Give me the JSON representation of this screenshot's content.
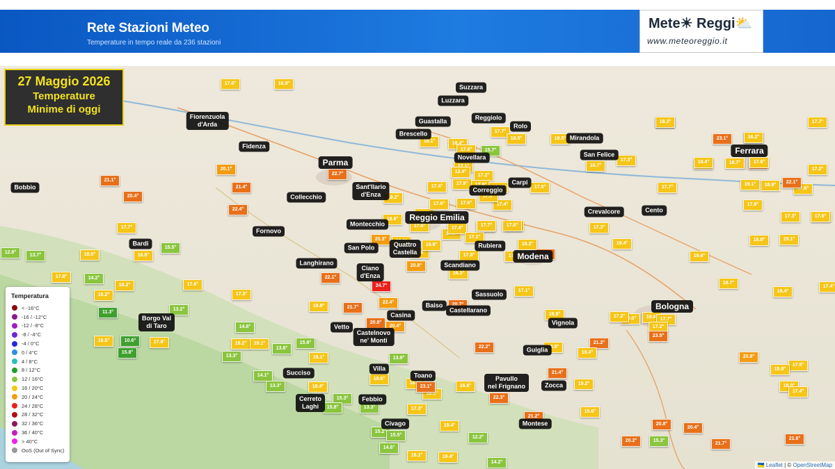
{
  "header": {
    "title": "Rete Stazioni Meteo",
    "subtitle": "Temperature in tempo reale da 236 stazioni",
    "logo_name": "Mete☀ Reggi⛅",
    "logo_url": "www.meteoreggio.it"
  },
  "map_title": {
    "date": "27 Maggio 2026",
    "line1": "Temperature",
    "line2": "Minime di oggi"
  },
  "colors": {
    "g1": "#3fa02e",
    "g2": "#8bc53f",
    "y": "#f5c518",
    "o": "#f39c12",
    "d": "#e8701a",
    "r": "#e8211d"
  },
  "markers": [
    {
      "v": "17.6°",
      "c": "y"
    },
    {
      "v": "16.9°",
      "c": "y"
    },
    {
      "v": "19.2°",
      "c": "y"
    },
    {
      "v": "17.6°",
      "c": "y"
    },
    {
      "v": "17.6°",
      "c": "y"
    },
    {
      "v": "16.2°",
      "c": "y"
    },
    {
      "v": "18.2°",
      "c": "y"
    },
    {
      "v": "19.4°",
      "c": "y"
    },
    {
      "v": "17.7°",
      "c": "y"
    },
    {
      "v": "22.1°",
      "c": "d"
    },
    {
      "v": "17.6°",
      "c": "y"
    },
    {
      "v": "20.1°",
      "c": "o"
    },
    {
      "v": "21.1°",
      "c": "d"
    },
    {
      "v": "20.4°",
      "c": "d"
    },
    {
      "v": "21.4°",
      "c": "d"
    },
    {
      "v": "22.4°",
      "c": "d"
    },
    {
      "v": "22.7°",
      "c": "d"
    },
    {
      "v": "18.6°",
      "c": "y"
    },
    {
      "v": "17.7°",
      "c": "y"
    },
    {
      "v": "17.3°",
      "c": "y"
    },
    {
      "v": "18.1°",
      "c": "y"
    },
    {
      "v": "12.8°",
      "c": "g2"
    },
    {
      "v": "13.7°",
      "c": "g2"
    },
    {
      "v": "15.5°",
      "c": "g2"
    },
    {
      "v": "18.6°",
      "c": "y"
    },
    {
      "v": "16.8°",
      "c": "y"
    },
    {
      "v": "16.2°",
      "c": "y"
    },
    {
      "v": "14.2°",
      "c": "g2"
    },
    {
      "v": "18.2°",
      "c": "y"
    },
    {
      "v": "17.6°",
      "c": "y"
    },
    {
      "v": "17.8°",
      "c": "y"
    },
    {
      "v": "11.3°",
      "c": "g1"
    },
    {
      "v": "13.2°",
      "c": "g2"
    },
    {
      "v": "10.6°",
      "c": "g1"
    },
    {
      "v": "15.8°",
      "c": "g1"
    },
    {
      "v": "16.5°",
      "c": "y"
    },
    {
      "v": "17.8°",
      "c": "y"
    },
    {
      "v": "17.3°",
      "c": "y"
    },
    {
      "v": "14.8°",
      "c": "g2"
    },
    {
      "v": "18.2°",
      "c": "y"
    },
    {
      "v": "19.1°",
      "c": "y"
    },
    {
      "v": "13.8°",
      "c": "g2"
    },
    {
      "v": "15.8°",
      "c": "g2"
    },
    {
      "v": "13.3°",
      "c": "g2"
    },
    {
      "v": "14.1°",
      "c": "g2"
    },
    {
      "v": "13.3°",
      "c": "g2"
    },
    {
      "v": "18.4°",
      "c": "y"
    },
    {
      "v": "19.1°",
      "c": "y"
    },
    {
      "v": "22.1°",
      "c": "d"
    },
    {
      "v": "24.7°",
      "c": "r"
    },
    {
      "v": "22.4°",
      "c": "o"
    },
    {
      "v": "21.7°",
      "c": "d"
    },
    {
      "v": "20.8°",
      "c": "d"
    },
    {
      "v": "20.4°",
      "c": "o"
    },
    {
      "v": "19.8°",
      "c": "y"
    },
    {
      "v": "13.9°",
      "c": "g2"
    },
    {
      "v": "18.6°",
      "c": "y"
    },
    {
      "v": "18.5°",
      "c": "y"
    },
    {
      "v": "18.0°",
      "c": "y"
    },
    {
      "v": "15.3°",
      "c": "g2"
    },
    {
      "v": "15.8°",
      "c": "g2"
    },
    {
      "v": "13.3°",
      "c": "g2"
    },
    {
      "v": "17.3°",
      "c": "y"
    },
    {
      "v": "15.2°",
      "c": "g2"
    },
    {
      "v": "15.5°",
      "c": "g2"
    },
    {
      "v": "14.6°",
      "c": "g2"
    },
    {
      "v": "16.1°",
      "c": "y"
    },
    {
      "v": "16.4°",
      "c": "y"
    },
    {
      "v": "14.2°",
      "c": "g2"
    },
    {
      "v": "12.2°",
      "c": "g2"
    },
    {
      "v": "19.4°",
      "c": "y"
    },
    {
      "v": "20.3°",
      "c": "o"
    },
    {
      "v": "19.0°",
      "c": "y"
    },
    {
      "v": "20.8°",
      "c": "o"
    },
    {
      "v": "19.6°",
      "c": "y"
    },
    {
      "v": "17.5°",
      "c": "y"
    },
    {
      "v": "17.4°",
      "c": "y"
    },
    {
      "v": "16.2°",
      "c": "y"
    },
    {
      "v": "18.2°",
      "c": "y"
    },
    {
      "v": "17.4°",
      "c": "y"
    },
    {
      "v": "17.1°",
      "c": "y"
    },
    {
      "v": "17.8°",
      "c": "y"
    },
    {
      "v": "16.3°",
      "c": "y"
    },
    {
      "v": "23.1°",
      "c": "d"
    },
    {
      "v": "20.7°",
      "c": "d"
    },
    {
      "v": "18.4°",
      "c": "y"
    },
    {
      "v": "18.1°",
      "c": "y"
    },
    {
      "v": "17.8°",
      "c": "y"
    },
    {
      "v": "15.7°",
      "c": "g2"
    },
    {
      "v": "17.1°",
      "c": "y"
    },
    {
      "v": "17.2°",
      "c": "y"
    },
    {
      "v": "17.7°",
      "c": "y"
    },
    {
      "v": "18.5°",
      "c": "y"
    },
    {
      "v": "12.4°",
      "c": "y"
    },
    {
      "v": "17.9°",
      "c": "y"
    },
    {
      "v": "17.9°",
      "c": "y"
    },
    {
      "v": "17.4°",
      "c": "y"
    },
    {
      "v": "17.1°",
      "c": "y"
    },
    {
      "v": "17.5°",
      "c": "y"
    },
    {
      "v": "17.6°",
      "c": "y"
    },
    {
      "v": "16.9°",
      "c": "y"
    },
    {
      "v": "17.6°",
      "c": "y"
    },
    {
      "v": "17.3°",
      "c": "y"
    },
    {
      "v": "17.7°",
      "c": "y"
    },
    {
      "v": "17.6°",
      "c": "y"
    },
    {
      "v": "18.2°",
      "c": "y"
    },
    {
      "v": "17.1°",
      "c": "y"
    },
    {
      "v": "22.1°",
      "c": "d"
    },
    {
      "v": "17.1°",
      "c": "y"
    },
    {
      "v": "18.9°",
      "c": "y"
    },
    {
      "v": "18.5°",
      "c": "y"
    },
    {
      "v": "16.7°",
      "c": "y"
    },
    {
      "v": "17.3°",
      "c": "y"
    },
    {
      "v": "17.3°",
      "c": "y"
    },
    {
      "v": "17.7°",
      "c": "y"
    },
    {
      "v": "19.1°",
      "c": "y"
    },
    {
      "v": "19.4°",
      "c": "y"
    },
    {
      "v": "19.6°",
      "c": "y"
    },
    {
      "v": "18.0°",
      "c": "y"
    },
    {
      "v": "19.6°",
      "c": "y"
    },
    {
      "v": "17.2°",
      "c": "y"
    },
    {
      "v": "17.7°",
      "c": "y"
    },
    {
      "v": "17.2°",
      "c": "y"
    },
    {
      "v": "23.5°",
      "c": "d"
    },
    {
      "v": "21.2°",
      "c": "d"
    },
    {
      "v": "19.4°",
      "c": "y"
    },
    {
      "v": "21.4°",
      "c": "d"
    },
    {
      "v": "19.2°",
      "c": "y"
    },
    {
      "v": "18.8°",
      "c": "y"
    },
    {
      "v": "22.2°",
      "c": "d"
    },
    {
      "v": "16.8°",
      "c": "y"
    },
    {
      "v": "22.3°",
      "c": "d"
    },
    {
      "v": "21.2°",
      "c": "d"
    },
    {
      "v": "15.6°",
      "c": "y"
    },
    {
      "v": "20.2°",
      "c": "d"
    },
    {
      "v": "15.3°",
      "c": "g2"
    },
    {
      "v": "20.8°",
      "c": "d"
    },
    {
      "v": "20.4°",
      "c": "d"
    },
    {
      "v": "21.7°",
      "c": "d"
    },
    {
      "v": "21.6°",
      "c": "d"
    },
    {
      "v": "18.3°",
      "c": "y"
    },
    {
      "v": "23.1°",
      "c": "d"
    },
    {
      "v": "16.2°",
      "c": "y"
    },
    {
      "v": "18.7°",
      "c": "y"
    },
    {
      "v": "19.4°",
      "c": "y"
    },
    {
      "v": "17.6°",
      "c": "y"
    },
    {
      "v": "18.9°",
      "c": "y"
    },
    {
      "v": "22.1°",
      "c": "d"
    },
    {
      "v": "17.8°",
      "c": "y"
    },
    {
      "v": "19.1°",
      "c": "y"
    },
    {
      "v": "16.8°",
      "c": "y"
    },
    {
      "v": "18.7°",
      "c": "y"
    },
    {
      "v": "18.4°",
      "c": "y"
    },
    {
      "v": "17.4°",
      "c": "y"
    },
    {
      "v": "17.2°",
      "c": "y"
    },
    {
      "v": "17.6°",
      "c": "y"
    },
    {
      "v": "17.5°",
      "c": "y"
    },
    {
      "v": "18.0°",
      "c": "y"
    },
    {
      "v": "17.4°",
      "c": "y"
    },
    {
      "v": "20.8°",
      "c": "o"
    },
    {
      "v": "15.8°",
      "c": "y"
    },
    {
      "v": "18.5°",
      "c": "y"
    },
    {
      "v": "15.8°",
      "c": "y"
    },
    {
      "v": "17.6°",
      "c": "y"
    },
    {
      "v": "18.9°",
      "c": "y"
    }
  ],
  "cities": [
    {
      "label": "Suzzara",
      "big": false
    },
    {
      "label": "Luzzara",
      "big": false
    },
    {
      "label": "Guastalla",
      "big": false
    },
    {
      "label": "Reggiolo",
      "big": false
    },
    {
      "label": "Rolo",
      "big": false
    },
    {
      "label": "Brescello",
      "big": false
    },
    {
      "label": "Mirandola",
      "big": false
    },
    {
      "label": "Novellara",
      "big": false
    },
    {
      "label": "San Felice",
      "big": false
    },
    {
      "label": "Ferrara",
      "big": true
    },
    {
      "label": "Fiorenzuola\nd'Arda",
      "big": false
    },
    {
      "label": "Fidenza",
      "big": false
    },
    {
      "label": "Parma",
      "big": true
    },
    {
      "label": "Carpi",
      "big": false
    },
    {
      "label": "Correggio",
      "big": false
    },
    {
      "label": "Sant'Ilario\nd'Enza",
      "big": false
    },
    {
      "label": "Bobbio",
      "big": false
    },
    {
      "label": "Collecchio",
      "big": false
    },
    {
      "label": "Crevalcore",
      "big": false
    },
    {
      "label": "Cento",
      "big": false
    },
    {
      "label": "Reggio Emilia",
      "big": true
    },
    {
      "label": "Montecchio",
      "big": false
    },
    {
      "label": "Fornovo",
      "big": false
    },
    {
      "label": "Bardi",
      "big": false
    },
    {
      "label": "San Polo",
      "big": false
    },
    {
      "label": "Quattro\nCastella",
      "big": false
    },
    {
      "label": "Rubiera",
      "big": false
    },
    {
      "label": "Modena",
      "big": true
    },
    {
      "label": "Langhirano",
      "big": false
    },
    {
      "label": "Scandiano",
      "big": false
    },
    {
      "label": "Ciano\nd'Enza",
      "big": false
    },
    {
      "label": "Sassuolo",
      "big": false
    },
    {
      "label": "Baiso",
      "big": false
    },
    {
      "label": "Castellarano",
      "big": false
    },
    {
      "label": "Bologna",
      "big": true
    },
    {
      "label": "Casina",
      "big": false
    },
    {
      "label": "Borgo Val\ndi Taro",
      "big": false
    },
    {
      "label": "Vetto",
      "big": false
    },
    {
      "label": "Vignola",
      "big": false
    },
    {
      "label": "Castelnovo\nne' Monti",
      "big": false
    },
    {
      "label": "Guiglia",
      "big": false
    },
    {
      "label": "Villa",
      "big": false
    },
    {
      "label": "Succiso",
      "big": false
    },
    {
      "label": "Toano",
      "big": false
    },
    {
      "label": "Pavullo\nnel Frignano",
      "big": false
    },
    {
      "label": "Zocca",
      "big": false
    },
    {
      "label": "Febbio",
      "big": false
    },
    {
      "label": "Cerreto\nLaghi",
      "big": false
    },
    {
      "label": "Civago",
      "big": false
    },
    {
      "label": "Montese",
      "big": false
    }
  ],
  "legend": {
    "title": "Temperatura",
    "items": [
      {
        "label": "< -16°C",
        "color": "#8b0a0a"
      },
      {
        "label": "-16 / -12°C",
        "color": "#8a1a8a"
      },
      {
        "label": "-12 / -8°C",
        "color": "#a020c0"
      },
      {
        "label": "-8 / -4°C",
        "color": "#6a2ad0"
      },
      {
        "label": "-4 / 0°C",
        "color": "#2a2ad8"
      },
      {
        "label": "0 / 4°C",
        "color": "#2a8fe0"
      },
      {
        "label": "4 / 8°C",
        "color": "#28c0c0"
      },
      {
        "label": "8 / 12°C",
        "color": "#1f9e2a"
      },
      {
        "label": "12 / 16°C",
        "color": "#8bc53f"
      },
      {
        "label": "16 / 20°C",
        "color": "#f5c518"
      },
      {
        "label": "20 / 24°C",
        "color": "#f39c12"
      },
      {
        "label": "24 / 28°C",
        "color": "#e8211d"
      },
      {
        "label": "28 / 32°C",
        "color": "#b01010"
      },
      {
        "label": "32 / 36°C",
        "color": "#8a1a5a"
      },
      {
        "label": "36 / 40°C",
        "color": "#c020c0"
      },
      {
        "label": "> 40°C",
        "color": "#f020f0"
      },
      {
        "label": "OoS (Out of Sync)",
        "color": "#9a9a9a"
      }
    ]
  },
  "attribution": {
    "leaflet": "🇺🇦 Leaflet",
    "sep": " | © ",
    "osm": "OpenStreetMap"
  }
}
